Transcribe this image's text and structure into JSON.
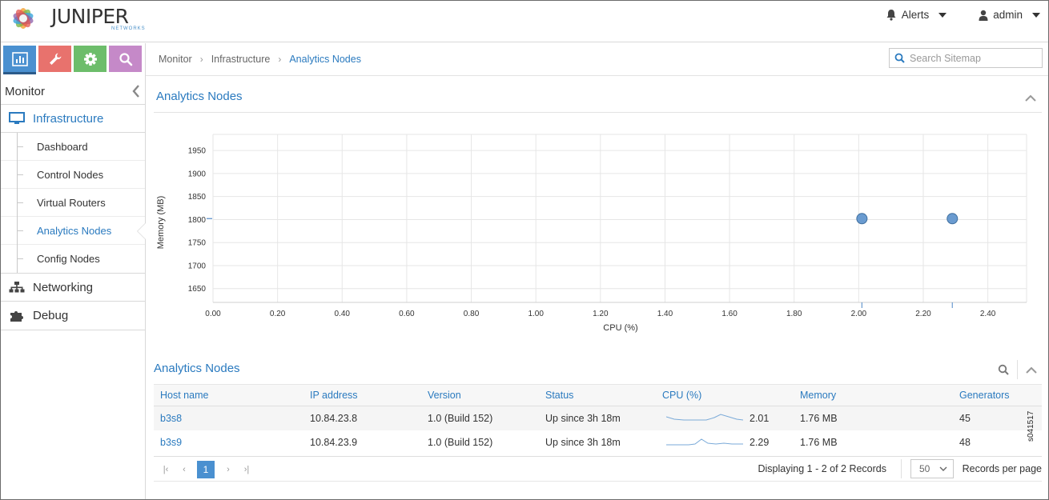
{
  "app": {
    "logo_word": "JUNIPER",
    "logo_sub": "NETWORKS"
  },
  "topbar": {
    "alerts_label": "Alerts",
    "user_label": "admin"
  },
  "sidebar": {
    "header": "Monitor",
    "sections": [
      {
        "label": "Infrastructure",
        "icon": "monitor-icon",
        "active": true
      },
      {
        "label": "Networking",
        "icon": "network-icon",
        "active": false
      },
      {
        "label": "Debug",
        "icon": "puzzle-icon",
        "active": false
      }
    ],
    "sub_items": [
      {
        "label": "Dashboard"
      },
      {
        "label": "Control Nodes"
      },
      {
        "label": "Virtual Routers"
      },
      {
        "label": "Analytics Nodes",
        "active": true
      },
      {
        "label": "Config Nodes"
      }
    ],
    "tab_icons": [
      "bar-chart-icon",
      "wrench-icon",
      "gear-icon",
      "search-icon"
    ],
    "colors": {
      "monitor": "#4a90d0",
      "configure": "#e8726d",
      "settings": "#6dbd6b",
      "query": "#c589c8"
    }
  },
  "breadcrumb": [
    "Monitor",
    "Infrastructure",
    "Analytics Nodes"
  ],
  "search": {
    "placeholder": "Search Sitemap"
  },
  "chart_panel": {
    "title": "Analytics Nodes"
  },
  "chart_data": {
    "type": "scatter",
    "title": "",
    "xlabel": "CPU (%)",
    "ylabel": "Memory (MB)",
    "xlim": [
      0,
      2.52
    ],
    "ylim": [
      1620,
      1985
    ],
    "xticks": [
      "0.00",
      "0.20",
      "0.40",
      "0.60",
      "0.80",
      "1.00",
      "1.20",
      "1.40",
      "1.60",
      "1.80",
      "2.00",
      "2.20",
      "2.40"
    ],
    "xtick_values": [
      0,
      0.2,
      0.4,
      0.6,
      0.8,
      1.0,
      1.2,
      1.4,
      1.6,
      1.8,
      2.0,
      2.2,
      2.4
    ],
    "yticks": [
      "1950",
      "1900",
      "1850",
      "1800",
      "1750",
      "1700",
      "1650"
    ],
    "ytick_values": [
      1950,
      1900,
      1850,
      1800,
      1750,
      1700,
      1650
    ],
    "grid": true,
    "points": [
      {
        "name": "b3s8",
        "x": 2.01,
        "y": 1802
      },
      {
        "name": "b3s9",
        "x": 2.29,
        "y": 1802
      }
    ],
    "point_color": "#6a9bd0"
  },
  "grid": {
    "title": "Analytics Nodes",
    "columns": [
      "Host name",
      "IP address",
      "Version",
      "Status",
      "CPU (%)",
      "Memory",
      "Generators"
    ],
    "rows": [
      {
        "host": "b3s8",
        "ip": "10.84.23.8",
        "version": "1.0 (Build 152)",
        "status": "Up since 3h 18m",
        "cpu": "2.01",
        "memory": "1.76 MB",
        "generators": "45"
      },
      {
        "host": "b3s9",
        "ip": "10.84.23.9",
        "version": "1.0 (Build 152)",
        "status": "Up since 3h 18m",
        "cpu": "2.29",
        "memory": "1.76 MB",
        "generators": "48"
      }
    ],
    "pager": {
      "current_page": "1",
      "info": "Displaying 1 - 2 of 2 Records",
      "page_size": "50",
      "per_page_label": "Records per page"
    }
  },
  "figure_id": "s041517"
}
